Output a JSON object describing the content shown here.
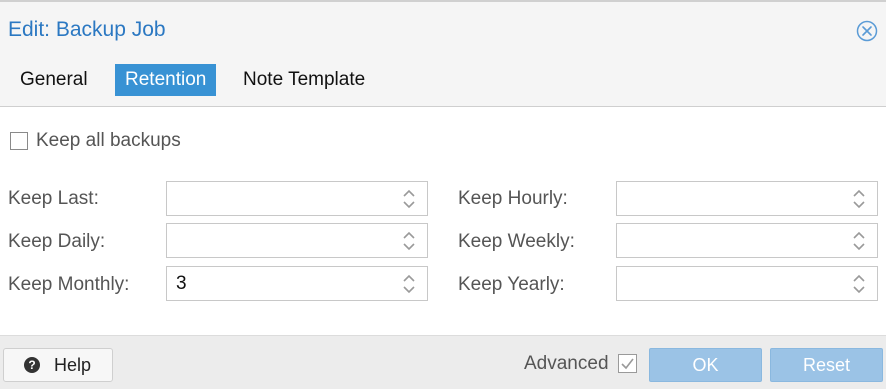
{
  "dialog": {
    "title": "Edit: Backup Job"
  },
  "tabs": [
    {
      "label": "General",
      "active": false
    },
    {
      "label": "Retention",
      "active": true
    },
    {
      "label": "Note Template",
      "active": false
    }
  ],
  "retention": {
    "keep_all": {
      "label": "Keep all backups",
      "checked": false
    },
    "fields": {
      "keep_last": {
        "label": "Keep Last:",
        "value": ""
      },
      "keep_hourly": {
        "label": "Keep Hourly:",
        "value": ""
      },
      "keep_daily": {
        "label": "Keep Daily:",
        "value": ""
      },
      "keep_weekly": {
        "label": "Keep Weekly:",
        "value": ""
      },
      "keep_monthly": {
        "label": "Keep Monthly:",
        "value": "3"
      },
      "keep_yearly": {
        "label": "Keep Yearly:",
        "value": ""
      }
    }
  },
  "footer": {
    "help_label": "Help",
    "advanced_label": "Advanced",
    "advanced_checked": true,
    "ok_label": "OK",
    "reset_label": "Reset"
  },
  "colors": {
    "title": "#2b78c2",
    "tab_active_bg": "#3892d4",
    "button_disabled_bg": "#9bc3e6"
  },
  "icons": {
    "close": "close-circle-icon",
    "help": "question-circle-icon",
    "spinner": "up-down-chevron-icon"
  }
}
